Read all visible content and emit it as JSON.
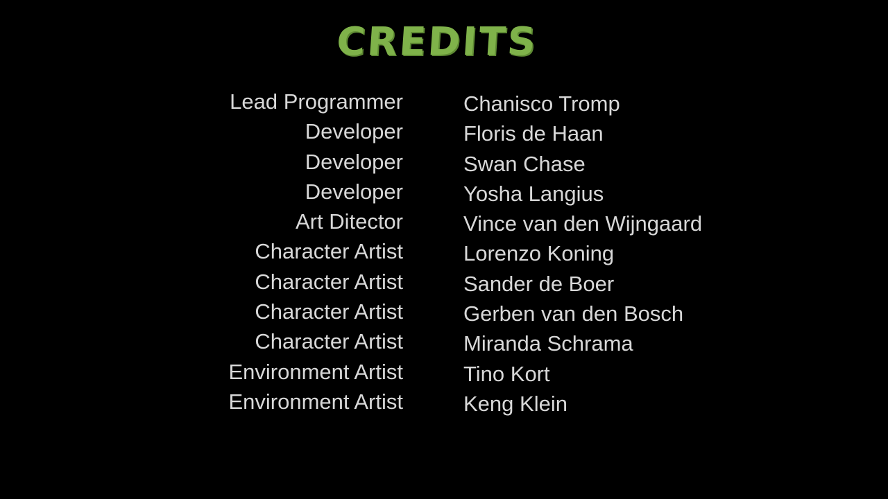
{
  "title": "CREDITS",
  "colors": {
    "background": "#000000",
    "title": "#7fb24a",
    "text": "#d8d8d8"
  },
  "credits": [
    {
      "role": "Lead Programmer",
      "name": "Chanisco Tromp"
    },
    {
      "role": "Developer",
      "name": "Floris de Haan"
    },
    {
      "role": "Developer",
      "name": "Swan Chase"
    },
    {
      "role": "Developer",
      "name": "Yosha Langius"
    },
    {
      "role": "Art Ditector",
      "name": "Vince van den Wijngaard"
    },
    {
      "role": "Character Artist",
      "name": "Lorenzo Koning"
    },
    {
      "role": "Character Artist",
      "name": "Sander de Boer"
    },
    {
      "role": "Character Artist",
      "name": "Gerben van den Bosch"
    },
    {
      "role": "Character Artist",
      "name": "Miranda Schrama"
    },
    {
      "role": "Environment Artist",
      "name": "Tino Kort"
    },
    {
      "role": "Environment Artist",
      "name": "Keng Klein"
    }
  ]
}
